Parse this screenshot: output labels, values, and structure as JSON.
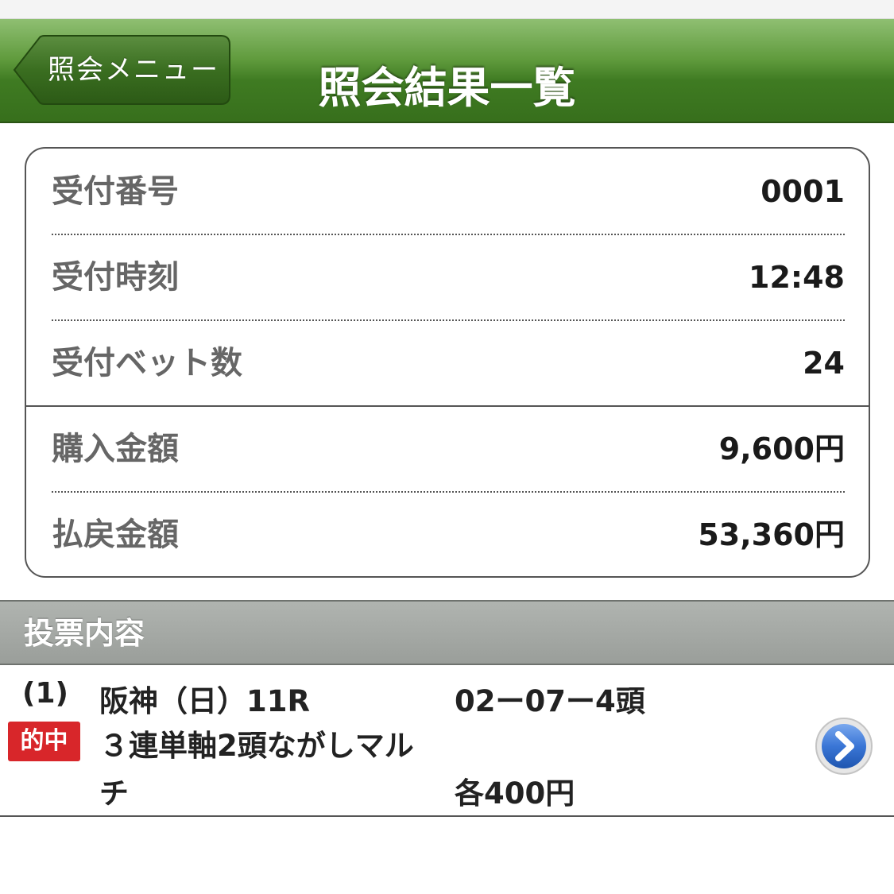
{
  "navbar": {
    "back_label": "照会メニュー",
    "title": "照会結果一覧"
  },
  "summary": {
    "rows": [
      {
        "label": "受付番号",
        "value": "0001"
      },
      {
        "label": "受付時刻",
        "value": "12:48"
      },
      {
        "label": "受付ベット数",
        "value": "24"
      },
      {
        "label": "購入金額",
        "value": "9,600円"
      },
      {
        "label": "払戻金額",
        "value": "53,360円"
      }
    ]
  },
  "section": {
    "title": "投票内容"
  },
  "bets": [
    {
      "number": "(1)",
      "badge": "的中",
      "venue": "阪神（日）11R",
      "type_line1": "３連単軸2頭ながしマル",
      "type_line2": "チ",
      "combo": "02ー07ー4頭",
      "amount": "各400円"
    }
  ],
  "colors": {
    "navbar_green": "#3f7b22",
    "hit_badge_red": "#d8262a",
    "detail_button_blue": "#2f6fd0",
    "section_gray": "#9a9e9a"
  },
  "icons": {
    "back": "back-arrow-button",
    "detail": "chevron-right-circle-icon"
  }
}
